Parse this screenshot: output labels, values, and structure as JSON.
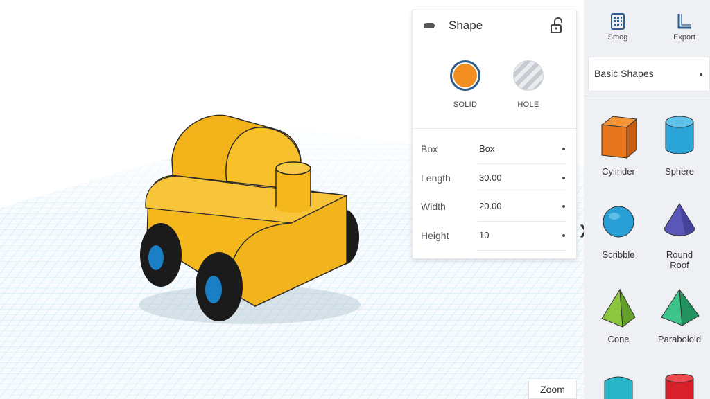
{
  "inspector": {
    "title": "Shape",
    "modes": [
      {
        "label": "SOLID",
        "selected": true,
        "color": "#f28d1f"
      },
      {
        "label": "HOLE",
        "selected": false
      }
    ],
    "properties": [
      {
        "label": "Box",
        "value": "Box"
      },
      {
        "label": "Length",
        "value": "30.00"
      },
      {
        "label": "Width",
        "value": "20.00"
      },
      {
        "label": "Height",
        "value": "10"
      }
    ]
  },
  "sidebar": {
    "top_buttons": [
      {
        "label": "Smog",
        "icon": "grid-panel-icon"
      },
      {
        "label": "Export",
        "icon": "l-ruler-icon"
      }
    ],
    "category": "Basic Shapes",
    "shapes": [
      {
        "label": "Cylinder",
        "icon": "orange-box-icon",
        "color": "#e8761c"
      },
      {
        "label": "Sphere",
        "icon": "blue-cylinder-icon",
        "color": "#2aa3d6"
      },
      {
        "label": "Scribble",
        "icon": "blue-sphere-icon",
        "color": "#2a9fd6"
      },
      {
        "label": "Round\nRoof",
        "icon": "purple-cone-icon",
        "color": "#5a57b8"
      },
      {
        "label": "Cone",
        "icon": "green-pyramid-icon",
        "color": "#7cb83a"
      },
      {
        "label": "Paraboloid",
        "icon": "teal-pyramid-icon",
        "color": "#2fb27a"
      },
      {
        "label": "",
        "icon": "teal-shape-icon",
        "color": "#2ab6c9"
      },
      {
        "label": "",
        "icon": "red-shape-icon",
        "color": "#d8202a"
      }
    ]
  },
  "side_arrow": "❯",
  "zoom": {
    "label": "Zoom"
  },
  "scene": {
    "object": "yellow-toy-car",
    "body_color": "#f5b81c",
    "wheel_color": "#1b1b1b",
    "hub_color": "#1a7fc4",
    "grid_color": "#bfe3f5"
  }
}
